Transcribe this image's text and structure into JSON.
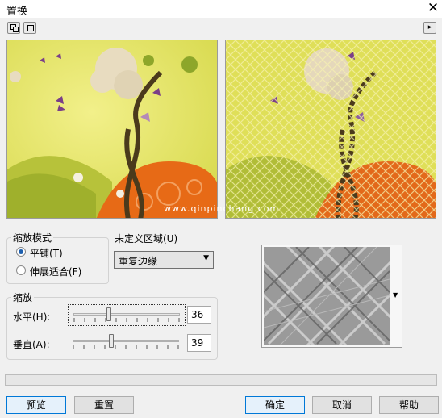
{
  "window": {
    "title": "置换",
    "close_glyph": "✕"
  },
  "toolbar": {
    "icons": [
      "window-restore-icon",
      "window-single-icon"
    ],
    "expand_glyph": "▸"
  },
  "previews": {
    "watermark": "www.qinpinchang.com"
  },
  "scale_mode": {
    "group_label": "缩放模式",
    "options": [
      {
        "label": "平铺(T)",
        "selected": true
      },
      {
        "label": "伸展适合(F)",
        "selected": false
      }
    ]
  },
  "undefined_area": {
    "label": "未定义区域(U)",
    "selected": "重复边缘"
  },
  "scale": {
    "group_label": "缩放",
    "horizontal_label": "水平(H):",
    "horizontal_value": "36",
    "vertical_label": "垂直(A):",
    "vertical_value": "39"
  },
  "buttons": {
    "preview": "预览",
    "reset": "重置",
    "ok": "确定",
    "cancel": "取消",
    "help": "帮助"
  },
  "colors": {
    "accent": "#0078d7",
    "selected_radio": "#1d5fae",
    "dialog_bg": "#f0f0f0"
  }
}
